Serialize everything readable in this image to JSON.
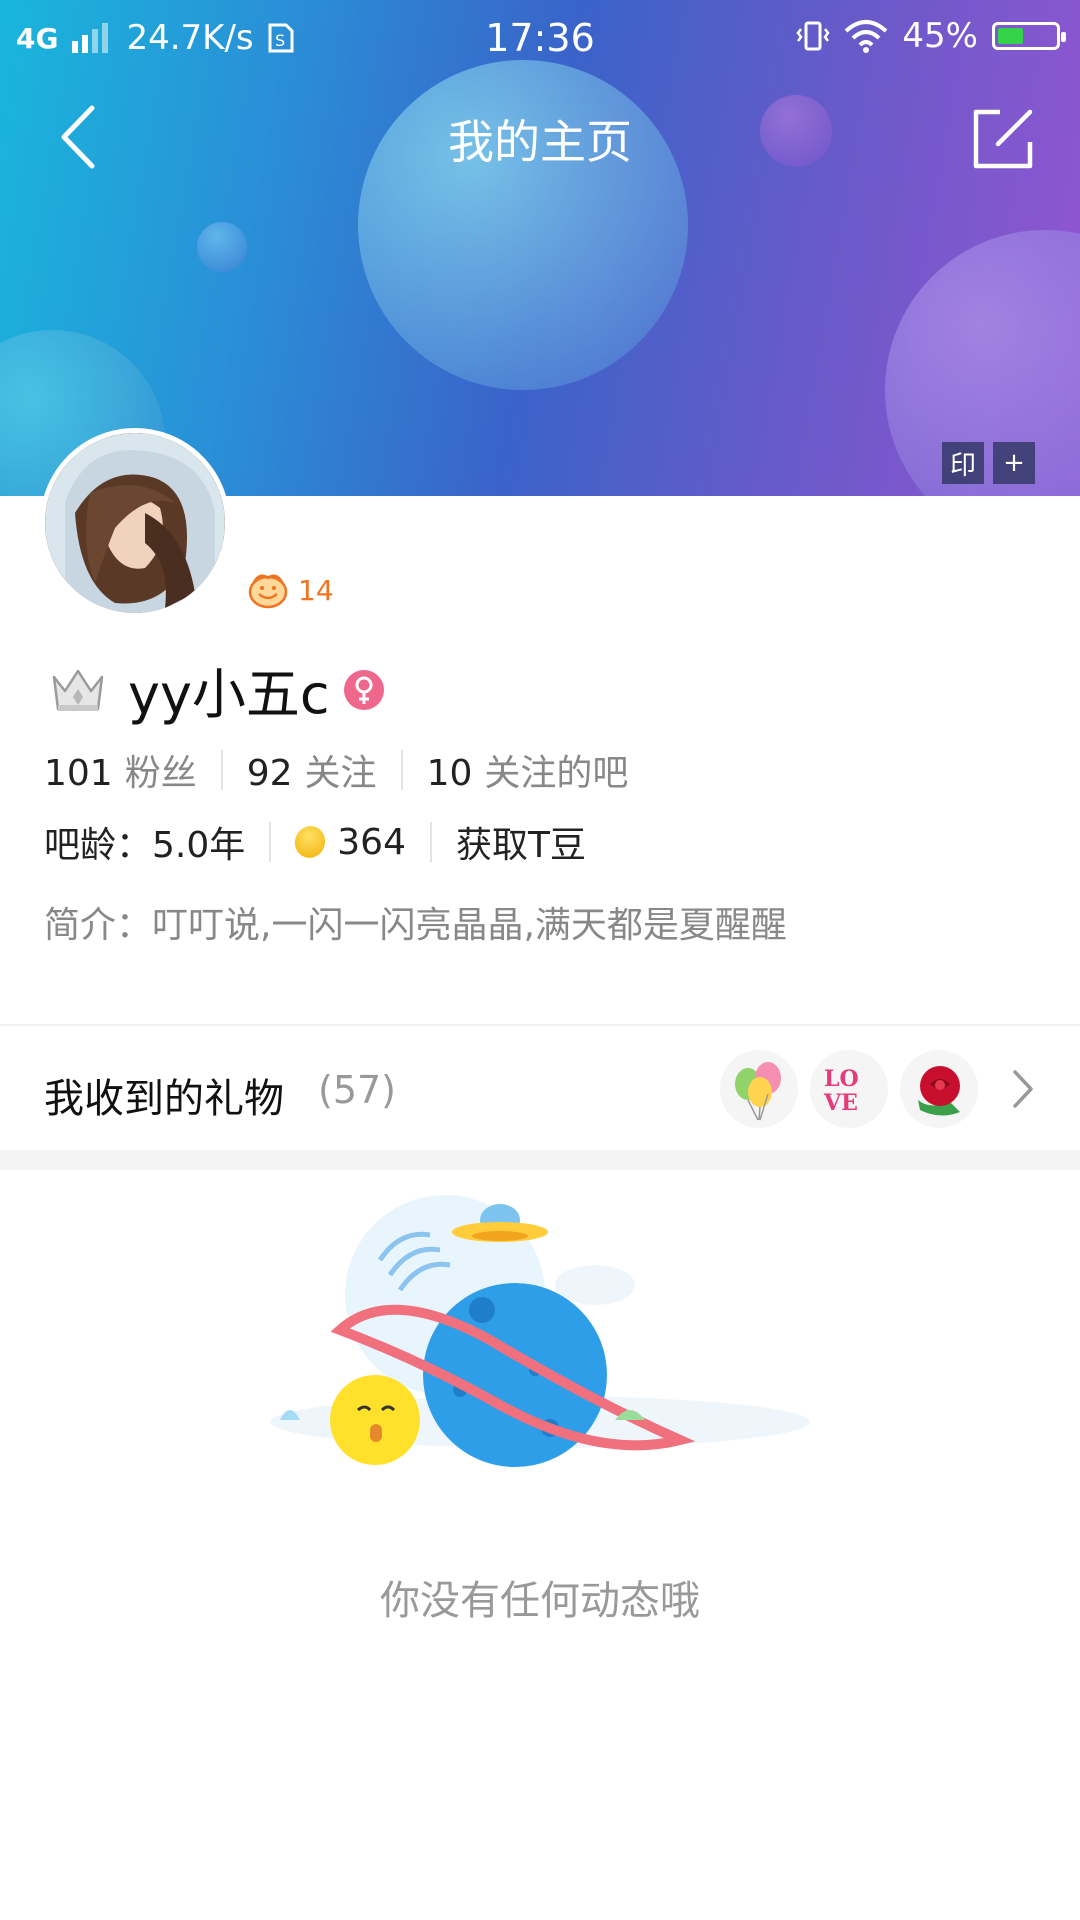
{
  "status_bar": {
    "network": "4G",
    "speed": "24.7K/s",
    "time": "17:36",
    "battery": "45%",
    "battery_level": 0.45
  },
  "header": {
    "title": "我的主页",
    "stamp_label": "印",
    "add_label": "+"
  },
  "profile": {
    "level": "14",
    "username": "yy小五c",
    "stats": [
      {
        "num": "101",
        "label": "粉丝"
      },
      {
        "num": "92",
        "label": "关注"
      },
      {
        "num": "10",
        "label": "关注的吧"
      }
    ],
    "bar_age_label": "吧龄：",
    "bar_age_value": "5.0年",
    "tdou_count": "364",
    "get_tdou": "获取T豆",
    "bio_label": "简介：",
    "bio": "叮叮说,一闪一闪亮晶晶,满天都是夏醒醒"
  },
  "gifts": {
    "label": "我收到的礼物",
    "count": "(57)"
  },
  "empty": {
    "text": "你没有任何动态哦"
  }
}
